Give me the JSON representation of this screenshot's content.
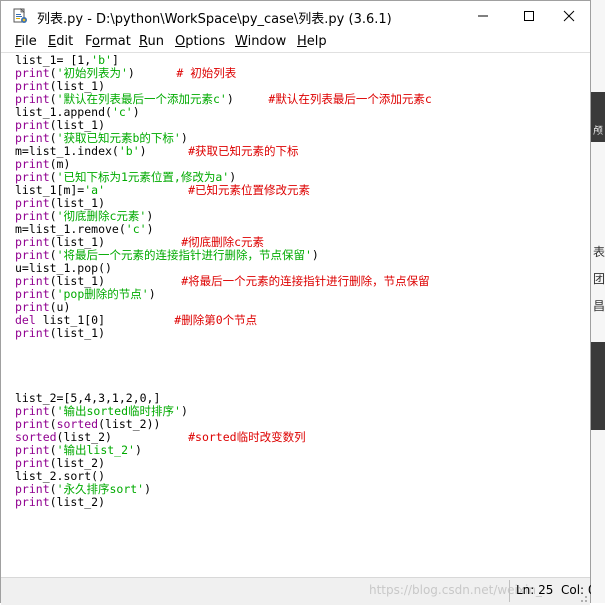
{
  "window": {
    "title": "列表.py - D:\\python\\WorkSpace\\py_case\\列表.py (3.6.1)"
  },
  "menu": [
    {
      "mnemonic": "F",
      "rest": "ile"
    },
    {
      "mnemonic": "E",
      "rest": "dit"
    },
    {
      "mnemonic": "",
      "pre": "F",
      "rest": "ormat",
      "u_index": 1
    },
    {
      "mnemonic": "R",
      "rest": "un"
    },
    {
      "mnemonic": "O",
      "rest": "ptions"
    },
    {
      "mnemonic": "W",
      "rest": "indow"
    },
    {
      "mnemonic": "H",
      "rest": "elp"
    }
  ],
  "code": [
    [
      [
        "",
        "list_1= [1,"
      ],
      [
        "st",
        "'b'"
      ],
      [
        "",
        "]"
      ]
    ],
    [
      [
        "kw",
        "print"
      ],
      [
        "",
        "("
      ],
      [
        "st",
        "'初始列表为'"
      ],
      [
        "",
        ")      "
      ],
      [
        "cm",
        "# 初始列表"
      ]
    ],
    [
      [
        "kw",
        "print"
      ],
      [
        "",
        "(list_1)"
      ]
    ],
    [
      [
        "kw",
        "print"
      ],
      [
        "",
        "("
      ],
      [
        "st",
        "'默认在列表最后一个添加元素c'"
      ],
      [
        "",
        ")     "
      ],
      [
        "cm",
        "#默认在列表最后一个添加元素c"
      ]
    ],
    [
      [
        "",
        "list_1.append("
      ],
      [
        "st",
        "'c'"
      ],
      [
        "",
        ")"
      ]
    ],
    [
      [
        "kw",
        "print"
      ],
      [
        "",
        "(list_1)"
      ]
    ],
    [
      [
        "kw",
        "print"
      ],
      [
        "",
        "("
      ],
      [
        "st",
        "'获取已知元素b的下标'"
      ],
      [
        "",
        ")"
      ]
    ],
    [
      [
        "",
        "m=list_1.index("
      ],
      [
        "st",
        "'b'"
      ],
      [
        "",
        ")      "
      ],
      [
        "cm",
        "#获取已知元素的下标"
      ]
    ],
    [
      [
        "kw",
        "print"
      ],
      [
        "",
        "(m)"
      ]
    ],
    [
      [
        "kw",
        "print"
      ],
      [
        "",
        "("
      ],
      [
        "st",
        "'已知下标为1元素位置,修改为a'"
      ],
      [
        "",
        ")"
      ]
    ],
    [
      [
        "",
        "list_1[m]="
      ],
      [
        "st",
        "'a'"
      ],
      [
        "",
        "            "
      ],
      [
        "cm",
        "#已知元素位置修改元素"
      ]
    ],
    [
      [
        "kw",
        "print"
      ],
      [
        "",
        "(list_1)"
      ]
    ],
    [
      [
        "kw",
        "print"
      ],
      [
        "",
        "("
      ],
      [
        "st",
        "'彻底删除c元素'"
      ],
      [
        "",
        ")"
      ]
    ],
    [
      [
        "",
        "m=list_1.remove("
      ],
      [
        "st",
        "'c'"
      ],
      [
        "",
        ")"
      ]
    ],
    [
      [
        "kw",
        "print"
      ],
      [
        "",
        "(list_1)           "
      ],
      [
        "cm",
        "#彻底删除c元素"
      ]
    ],
    [
      [
        "kw",
        "print"
      ],
      [
        "",
        "("
      ],
      [
        "st",
        "'将最后一个元素的连接指针进行删除，节点保留'"
      ],
      [
        "",
        ")"
      ]
    ],
    [
      [
        "",
        "u=list_1.pop()"
      ]
    ],
    [
      [
        "kw",
        "print"
      ],
      [
        "",
        "(list_1)           "
      ],
      [
        "cm",
        "#将最后一个元素的连接指针进行删除，节点保留"
      ]
    ],
    [
      [
        "kw",
        "print"
      ],
      [
        "",
        "("
      ],
      [
        "st",
        "'pop删除的节点'"
      ],
      [
        "",
        ")"
      ]
    ],
    [
      [
        "kw",
        "print"
      ],
      [
        "",
        "(u)"
      ]
    ],
    [
      [
        "kw",
        "del"
      ],
      [
        "",
        " list_1[0]          "
      ],
      [
        "cm",
        "#删除第0个节点"
      ]
    ],
    [
      [
        "kw",
        "print"
      ],
      [
        "",
        "(list_1)"
      ]
    ],
    [],
    [],
    [],
    [],
    [
      [
        "",
        "list_2=[5,4,3,1,2,0,]"
      ]
    ],
    [
      [
        "kw",
        "print"
      ],
      [
        "",
        "("
      ],
      [
        "st",
        "'输出sorted临时排序'"
      ],
      [
        "",
        ")"
      ]
    ],
    [
      [
        "kw",
        "print"
      ],
      [
        "",
        "("
      ],
      [
        "kw",
        "sorted"
      ],
      [
        "",
        "(list_2))"
      ]
    ],
    [
      [
        "kw",
        "sorted"
      ],
      [
        "",
        "(list_2)           "
      ],
      [
        "cm",
        "#sorted临时改变数列"
      ]
    ],
    [
      [
        "kw",
        "print"
      ],
      [
        "",
        "("
      ],
      [
        "st",
        "'输出list_2'"
      ],
      [
        "",
        ")"
      ]
    ],
    [
      [
        "kw",
        "print"
      ],
      [
        "",
        "(list_2)"
      ]
    ],
    [
      [
        "",
        "list_2.sort()"
      ]
    ],
    [
      [
        "kw",
        "print"
      ],
      [
        "",
        "("
      ],
      [
        "st",
        "'永久排序sort'"
      ],
      [
        "",
        ")"
      ]
    ],
    [
      [
        "kw",
        "print"
      ],
      [
        "",
        "(list_2)"
      ]
    ]
  ],
  "status": {
    "watermark": "https://blog.csdn.net/weixin_",
    "line": "Ln: 25",
    "col": "Col: 0"
  },
  "right_strip": [
    "颅",
    "表",
    "团",
    "昌"
  ],
  "colors": {
    "keyword": "#900090",
    "string": "#00aa00",
    "comment": "#dd0000"
  }
}
